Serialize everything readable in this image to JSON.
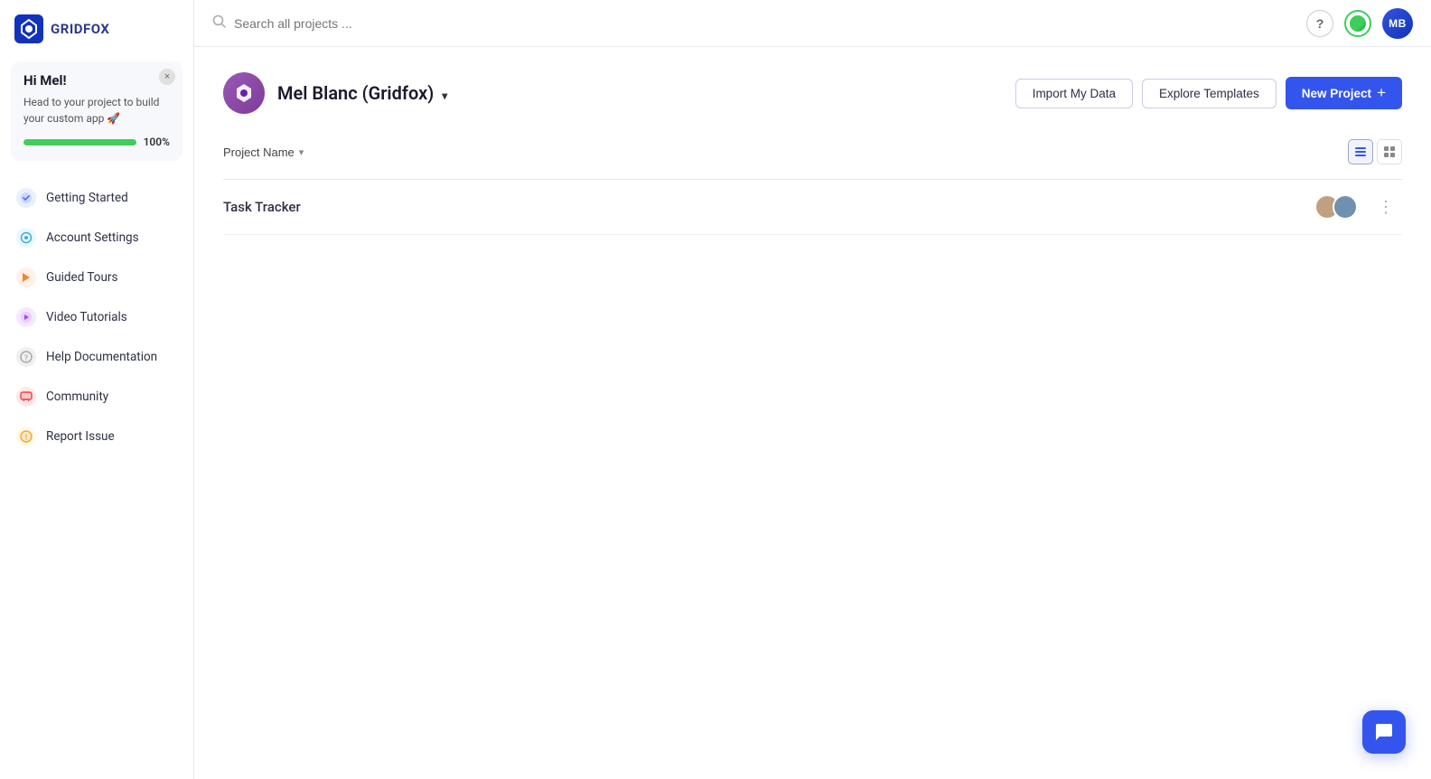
{
  "app": {
    "name": "GRIDFOX"
  },
  "sidebar": {
    "greeting": {
      "title": "Hi Mel!",
      "subtitle": "Head to your project to build your custom app 🚀",
      "progress_value": 100,
      "progress_label": "100%",
      "close_label": "×"
    },
    "nav_items": [
      {
        "id": "getting-started",
        "label": "Getting Started",
        "icon_color": "#e8f0fe",
        "icon_symbol": "✦",
        "icon_bg": "#5577ee"
      },
      {
        "id": "account-settings",
        "label": "Account Settings",
        "icon_color": "#e8f8ff",
        "icon_symbol": "⚙",
        "icon_bg": "#44aadd"
      },
      {
        "id": "guided-tours",
        "label": "Guided Tours",
        "icon_color": "#fff0e8",
        "icon_symbol": "⚡",
        "icon_bg": "#ee8833"
      },
      {
        "id": "video-tutorials",
        "label": "Video Tutorials",
        "icon_color": "#f5e8ff",
        "icon_symbol": "▶",
        "icon_bg": "#aa44ee"
      },
      {
        "id": "help-documentation",
        "label": "Help Documentation",
        "icon_color": "#f5f5f5",
        "icon_symbol": "?",
        "icon_bg": "#aaaaaa"
      },
      {
        "id": "community",
        "label": "Community",
        "icon_color": "#ffe8e8",
        "icon_symbol": "💬",
        "icon_bg": "#ee4444"
      },
      {
        "id": "report-issue",
        "label": "Report Issue",
        "icon_color": "#fff8e8",
        "icon_symbol": "!",
        "icon_bg": "#eeaa33"
      }
    ]
  },
  "header": {
    "search_placeholder": "Search all projects ...",
    "help_label": "?",
    "avatar_initials": "MB"
  },
  "user_bar": {
    "user_name": "Mel Blanc (Gridfox)",
    "import_btn": "Import My Data",
    "explore_btn": "Explore Templates",
    "new_project_btn": "New Project"
  },
  "project_list": {
    "sort_label": "Project Name",
    "projects": [
      {
        "name": "Task Tracker",
        "avatars": [
          "av-1",
          "av-2"
        ]
      }
    ]
  }
}
